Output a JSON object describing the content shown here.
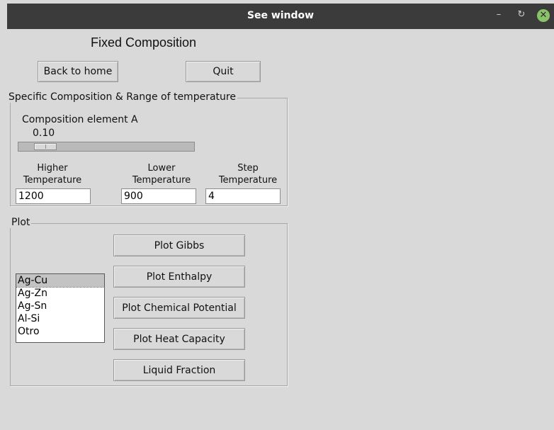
{
  "window": {
    "title": "See window",
    "controls": {
      "minimize": "–",
      "restore": "↻",
      "close": "✕"
    }
  },
  "heading": "Fixed Composition",
  "top_buttons": {
    "back": "Back to home",
    "quit": "Quit"
  },
  "composition_frame": {
    "title": "Specific Composition & Range of temperature",
    "slider_label": "Composition element A",
    "slider_value": "0.10",
    "slider_fraction": 0.1,
    "fields": [
      {
        "label_line1": "Higher",
        "label_line2": "Temperature",
        "value": "1200"
      },
      {
        "label_line1": "Lower",
        "label_line2": "Temperature",
        "value": "900"
      },
      {
        "label_line1": "Step",
        "label_line2": "Temperature",
        "value": "4"
      }
    ]
  },
  "plot_frame": {
    "title": "Plot",
    "buttons": {
      "gibbs": "Plot Gibbs",
      "enthalpy": "Plot Enthalpy",
      "chemical_potential": "Plot Chemical Potential",
      "heat_capacity": "Plot Heat Capacity",
      "liquid_fraction": "Liquid Fraction"
    },
    "systems": [
      "Ag-Cu",
      "Ag-Zn",
      "Ag-Sn",
      "Al-Si",
      "Otro"
    ],
    "selected_system": "Ag-Cu"
  },
  "colors": {
    "background": "#d9d9d9",
    "titlebar": "#3b3b3b",
    "close_button": "#8ac26a"
  }
}
